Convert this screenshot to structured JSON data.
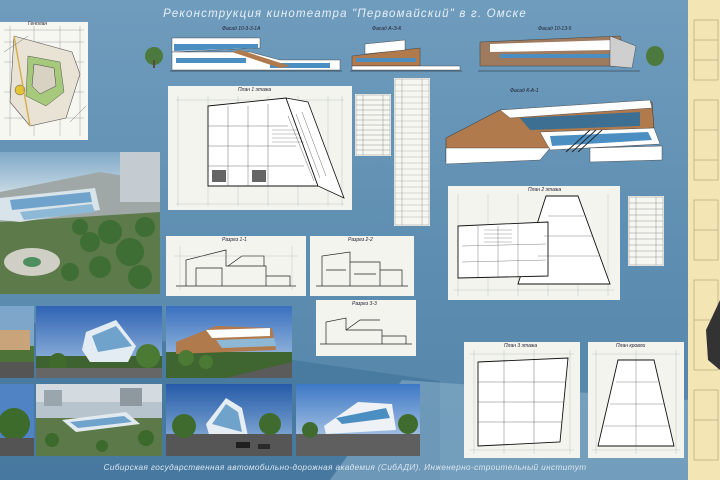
{
  "board": {
    "title": "Реконструкция кинотеатра \"Первомайский\" в г. Омске",
    "footer": "Сибирская государственная автомобильно-дорожная академия (СибАДИ). Инженерно-строительный институт"
  },
  "labels": {
    "genplan": "Генплан",
    "facade_1": "Фасад 10-3-3-1А",
    "facade_2": "Фасад А-Э-К",
    "facade_3": "Фасад 10-13-5",
    "facade_4": "Фасад К-А-1",
    "plan_floor1": "План 1 этажа",
    "plan_floor2": "План 2 этажа",
    "plan_floor3": "План 3 этажа",
    "plan_roof": "План кровли",
    "section_1": "Разрез 1-1",
    "section_2": "Разрез 2-2",
    "section_3": "Разрез 3-3"
  },
  "colors": {
    "background": "#5f8fb2",
    "accent_brown": "#b07a4c",
    "accent_glass": "#4b8fc2",
    "yellow_sheet": "#f3e5b4"
  }
}
